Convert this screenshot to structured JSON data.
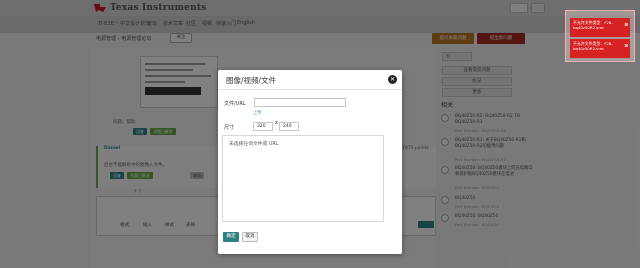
{
  "header": {
    "brand": "Texas Instruments",
    "nav": [
      "TI E2E™ 中文设计论坛",
      "论坛",
      "技术文章",
      "社区",
      "视频",
      "快速入门",
      "English"
    ]
  },
  "toolbar": {
    "breadcrumb": [
      "电源管理",
      "›",
      "电源管理论坛"
    ],
    "follow_label": "关注",
    "ask_label": "提问关联问题",
    "new_question_label": "提出新问题"
  },
  "content": {
    "question_label": "问题，帮助",
    "reply_a": "回复",
    "verify_a": "问题已解决",
    "author": "Daniel",
    "post_text": "后台不能解析中的图像入文件。",
    "reply_b": "回复",
    "verify_b": "问题已解决",
    "cancel_b": "取消",
    "editor_question": "？？",
    "editor_tools": [
      "格式",
      "插入",
      "样式",
      "表格"
    ],
    "points_text": "1975 points",
    "post_label": "回复"
  },
  "sidebar": {
    "twitter": "TI",
    "links": [
      "查看常见问题",
      "标记",
      "更多"
    ],
    "related_title": "相关",
    "related": [
      {
        "title": "BQ40Z50-R2: BQ40Z50-R2 TO BQ40Z50-R3",
        "part": "Part Number: BQ40Z50-R2"
      },
      {
        "title": "BQ40Z50-R1: 关于BQ40Z50-R1和BQ40Z50-R2的使用问题",
        "part": "Part Number: BQ40Z50-R1"
      },
      {
        "title": "BQ40Z50: BQ40Z50模块上的充电端口和保护板BQ40Z50模块在电池",
        "part": "Part Number: BQ40Z50"
      },
      {
        "title": "BQ40Z50",
        "part": "Part Number: BQ40Z50"
      },
      {
        "title": "BQ40Z50: BQ40Z50",
        "part": "Part Number: BQ40Z50"
      }
    ]
  },
  "modal": {
    "title": "图像/视频/文件",
    "url_label": "文件/URL",
    "url_value": "",
    "upload_label": "上传",
    "size_label": "尺寸",
    "width_value": "320",
    "separator": "x",
    "height_value": "240",
    "preview_text": "未选择任何文件或 URL",
    "ok_label": "确定",
    "cancel_label": "取消"
  },
  "toasts": [
    {
      "text": "不允许文件类型：F28-bq40z50R2.srec"
    },
    {
      "text": "不允许文件类型：F28-bq40z50R2.srec"
    }
  ],
  "colors": {
    "accent_teal": "#2f7f83",
    "brand_red": "#c8102e",
    "error_red": "#d62222",
    "amber": "#b5731d"
  }
}
